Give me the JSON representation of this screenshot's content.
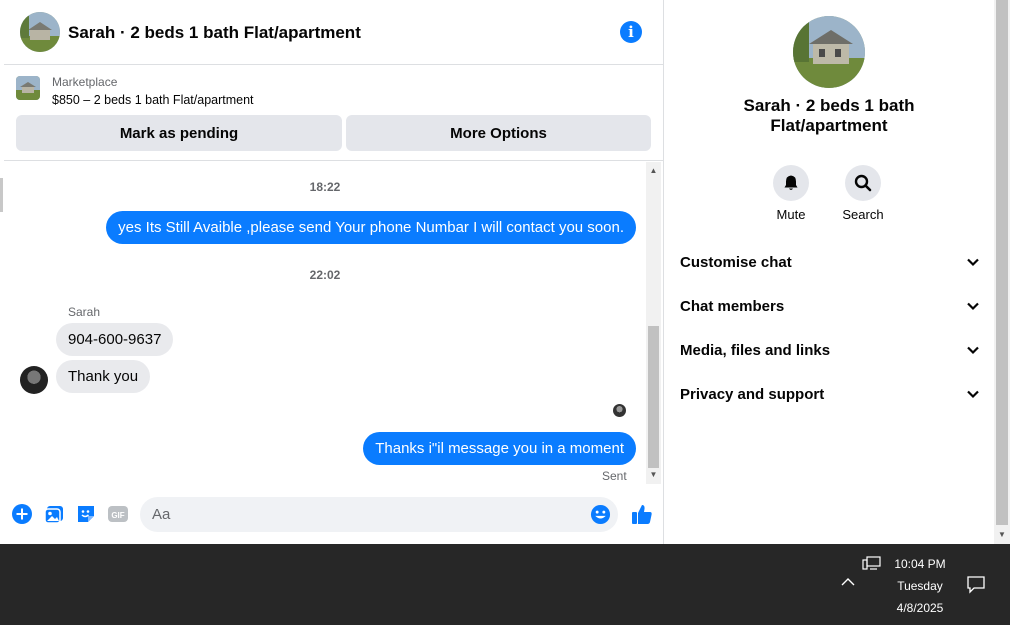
{
  "header": {
    "title": "Sarah · 2 beds 1 bath Flat/apartment"
  },
  "marketplace": {
    "label": "Marketplace",
    "item": "$850 – 2 beds 1 bath Flat/apartment",
    "pending_button": "Mark as pending",
    "more_button": "More Options"
  },
  "messages": {
    "time1": "18:22",
    "out1": "yes Its Still Avaible ,please send Your phone Numbar I will contact you soon.",
    "time2": "22:02",
    "sender": "Sarah",
    "in1": "904-600-9637",
    "in2": "Thank you",
    "out2": "Thanks i\"il message you in a moment",
    "status": "Sent"
  },
  "composer": {
    "placeholder": "Aa",
    "icons": [
      "plus-circle-icon",
      "photo-icon",
      "sticker-icon",
      "gif-icon",
      "emoji-icon",
      "thumbs-up-icon"
    ]
  },
  "info": {
    "name": "Sarah · 2 beds 1 bath Flat/apartment",
    "mute_label": "Mute",
    "search_label": "Search",
    "sections": [
      "Customise chat",
      "Chat members",
      "Media, files and links",
      "Privacy and support"
    ]
  },
  "taskbar": {
    "time": "10:04 PM",
    "day": "Tuesday",
    "date": "4/8/2025"
  },
  "colors": {
    "accent": "#0a7cff",
    "bubble_in": "#e9eaed",
    "button_bg": "#e4e6eb",
    "taskbar": "#272727"
  }
}
